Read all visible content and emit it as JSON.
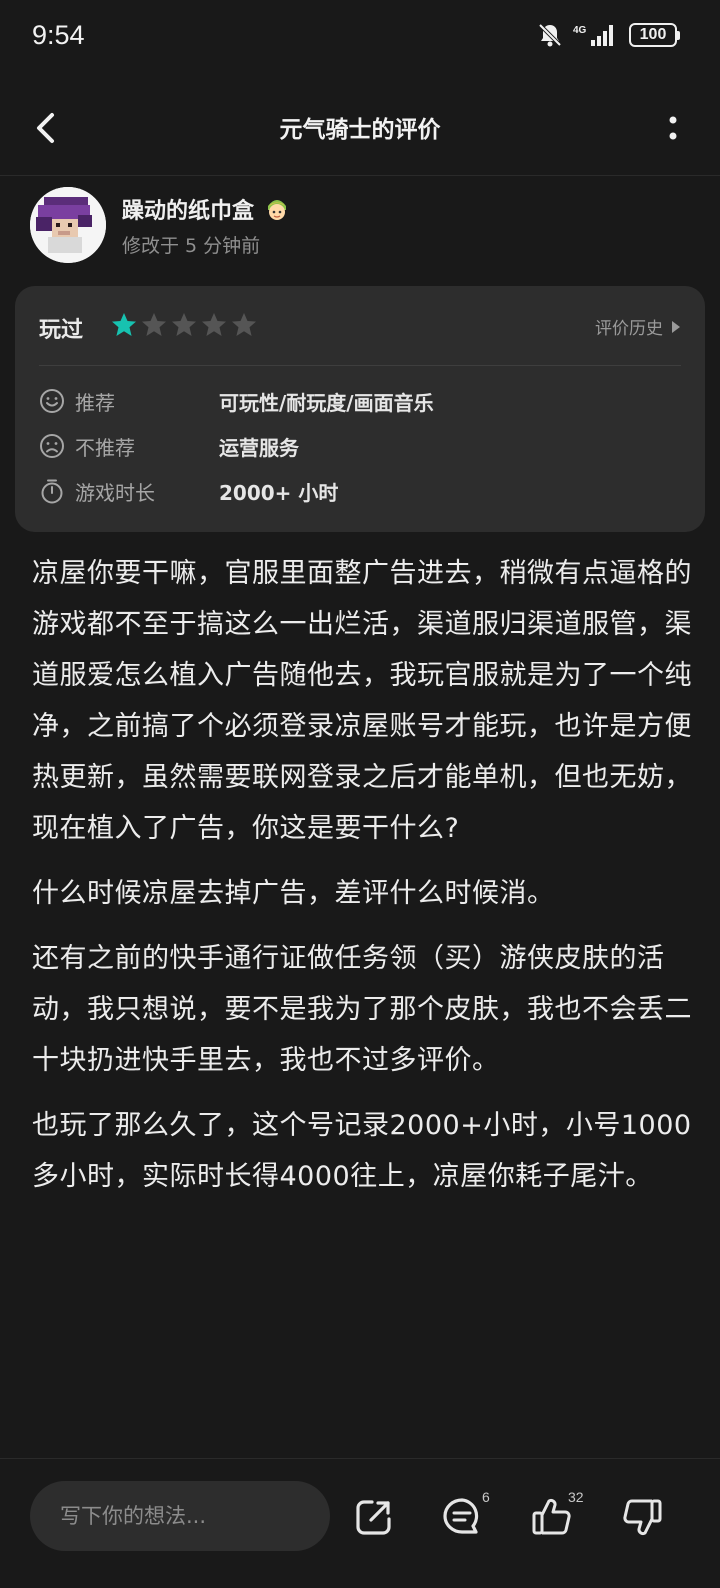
{
  "status_bar": {
    "time": "9:54",
    "battery": "100",
    "network": "4G"
  },
  "nav": {
    "title": "元气骑士的评价",
    "back_icon": "chevron-left-icon",
    "more_icon": "more-vertical-icon"
  },
  "author": {
    "name": "躁动的纸巾盒",
    "modified": "修改于 5 分钟前",
    "badge_icon": "character-badge-icon"
  },
  "rating": {
    "played_label": "玩过",
    "stars": 1,
    "max_stars": 5,
    "star_color": "#17c2b0",
    "history_label": "评价历史",
    "rows": [
      {
        "icon": "smile-icon",
        "label": "推荐",
        "value": "可玩性/耐玩度/画面音乐"
      },
      {
        "icon": "frown-icon",
        "label": "不推荐",
        "value": "运营服务"
      },
      {
        "icon": "stopwatch-icon",
        "label": "游戏时长",
        "value": "2000+ 小时"
      }
    ]
  },
  "review": {
    "paragraphs": [
      "凉屋你要干嘛，官服里面整广告进去，稍微有点逼格的游戏都不至于搞这么一出烂活，渠道服归渠道服管，渠道服爱怎么植入广告随他去，我玩官服就是为了一个纯净，之前搞了个必须登录凉屋账号才能玩，也许是方便热更新，虽然需要联网登录之后才能单机，但也无妨，现在植入了广告，你这是要干什么?",
      "什么时候凉屋去掉广告，差评什么时候消。",
      "还有之前的快手通行证做任务领（买）游侠皮肤的活动，我只想说，要不是我为了那个皮肤，我也不会丢二十块扔进快手里去，我也不过多评价。",
      "也玩了那么久了，这个号记录2000+小时，小号1000多小时，实际时长得4000往上，凉屋你耗子尾汁。"
    ]
  },
  "bottom_bar": {
    "comment_placeholder": "写下你的想法...",
    "share_icon": "share-icon",
    "comment_count": "6",
    "like_count": "32",
    "dislike_icon": "thumbs-down-icon"
  }
}
